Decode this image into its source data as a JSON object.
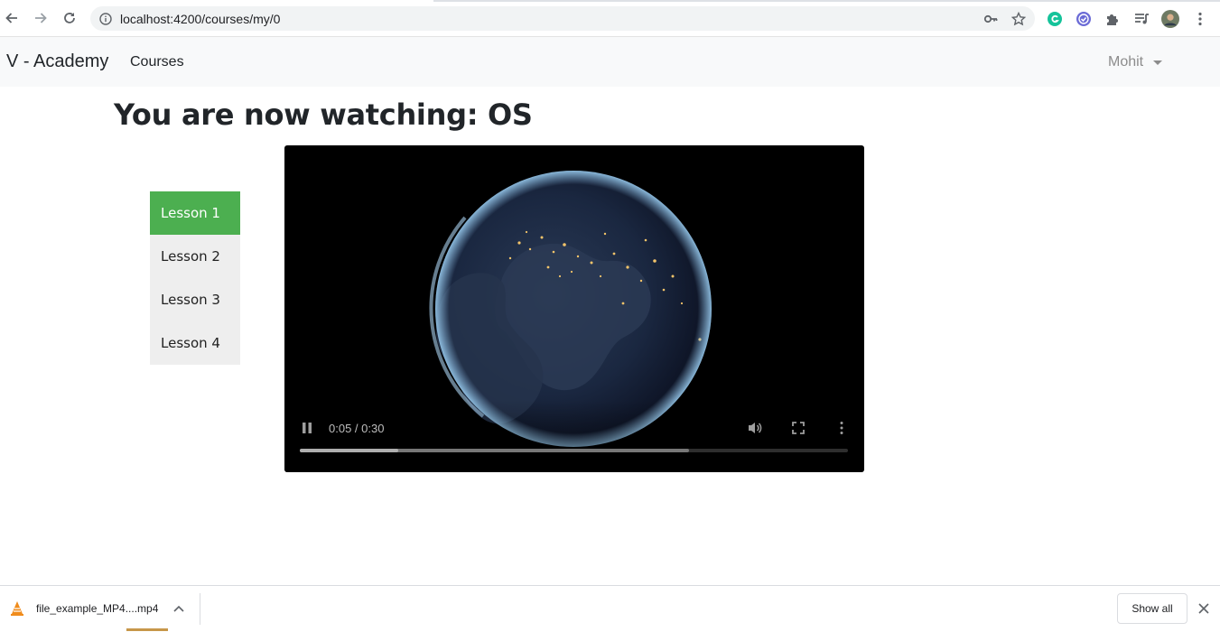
{
  "browser": {
    "url": "localhost:4200/courses/my/0",
    "icons": [
      "back-arrow-icon",
      "forward-arrow-icon",
      "reload-icon",
      "site-info-icon",
      "key-icon",
      "star-icon",
      "grammarly-icon",
      "extension-check-icon",
      "puzzle-icon",
      "media-queue-icon",
      "profile-avatar",
      "menu-dots-icon"
    ]
  },
  "navbar": {
    "brand": "V - Academy",
    "courses_label": "Courses",
    "user_label": "Mohit"
  },
  "main": {
    "title": "You are now watching: OS",
    "lessons": [
      {
        "label": "Lesson 1",
        "active": true
      },
      {
        "label": "Lesson 2",
        "active": false
      },
      {
        "label": "Lesson 3",
        "active": false
      },
      {
        "label": "Lesson 4",
        "active": false
      }
    ],
    "video": {
      "time_display": "0:05 / 0:30",
      "played_fraction": 0.18,
      "buffered_fraction": 0.71
    }
  },
  "downloads": {
    "file_name": "file_example_MP4....mp4",
    "show_all_label": "Show all"
  },
  "colors": {
    "active_lesson": "#4caf50",
    "lesson_bg": "#eeeeee",
    "navbar_bg": "#f8f9fa"
  }
}
